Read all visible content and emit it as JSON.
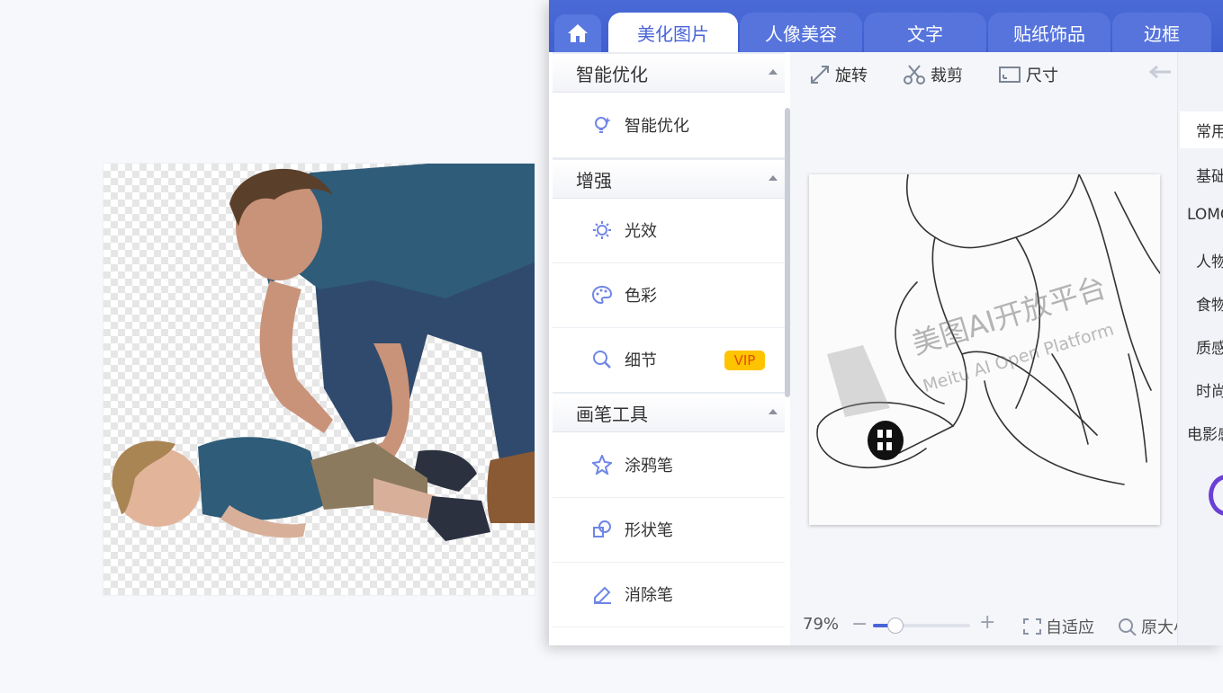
{
  "tabs": [
    {
      "label": "美化图片",
      "active": true
    },
    {
      "label": "人像美容",
      "active": false
    },
    {
      "label": "文字",
      "active": false
    },
    {
      "label": "贴纸饰品",
      "active": false
    },
    {
      "label": "边框",
      "active": false
    }
  ],
  "left_panel": {
    "sections": [
      {
        "title": "智能优化",
        "items": [
          {
            "label": "智能优化",
            "icon": "bulb-icon"
          }
        ]
      },
      {
        "title": "增强",
        "items": [
          {
            "label": "光效",
            "icon": "sun-icon"
          },
          {
            "label": "色彩",
            "icon": "palette-icon"
          },
          {
            "label": "细节",
            "icon": "magnifier-icon",
            "badge": "VIP"
          }
        ]
      },
      {
        "title": "画笔工具",
        "items": [
          {
            "label": "涂鸦笔",
            "icon": "doodle-pen-icon"
          },
          {
            "label": "形状笔",
            "icon": "shape-pen-icon"
          },
          {
            "label": "消除笔",
            "icon": "eraser-pen-icon"
          }
        ]
      }
    ]
  },
  "toolbar": {
    "rotate_label": "旋转",
    "crop_label": "裁剪",
    "size_label": "尺寸"
  },
  "watermark": {
    "line1": "美图AI开放平台",
    "line2": "Meitu AI Open Platform"
  },
  "zoom": {
    "value": "79%",
    "slider_fraction": 0.22,
    "fit_label": "自适应",
    "original_label": "原大小"
  },
  "right_panel": {
    "items": [
      "常用",
      "基础",
      "LOMO",
      "人物",
      "食物",
      "质感",
      "时尚",
      "电影感"
    ]
  },
  "colors": {
    "accent": "#4a64d8",
    "tabbar": "#3f5fcf",
    "vip_bg": "#ffc400"
  }
}
